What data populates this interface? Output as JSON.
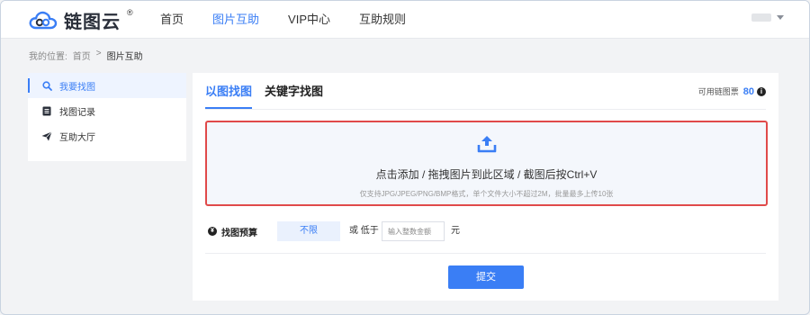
{
  "header": {
    "logo_text": "链图云",
    "logo_reg": "®",
    "nav": [
      {
        "label": "首页",
        "active": false
      },
      {
        "label": "图片互助",
        "active": true
      },
      {
        "label": "VIP中心",
        "active": false
      },
      {
        "label": "互助规则",
        "active": false
      }
    ]
  },
  "breadcrumb": {
    "prefix": "我的位置:",
    "home": "首页",
    "separator": ">",
    "current": "图片互助"
  },
  "sidebar": {
    "items": [
      {
        "label": "我要找图",
        "icon": "search-icon",
        "active": true
      },
      {
        "label": "找图记录",
        "icon": "document-icon",
        "active": false
      },
      {
        "label": "互助大厅",
        "icon": "paper-plane-icon",
        "active": false
      }
    ]
  },
  "main": {
    "tabs": [
      {
        "label": "以图找图",
        "active": true
      },
      {
        "label": "关键字找图",
        "active": false
      }
    ],
    "quota": {
      "label": "可用链图票",
      "value": "80"
    },
    "upload": {
      "main_text": "点击添加 / 拖拽图片到此区域 / 截图后按Ctrl+V",
      "hint": "仅支持JPG/JPEG/PNG/BMP格式，单个文件大小不超过2M，批量最多上传10张"
    },
    "budget": {
      "label": "找图预算",
      "unlimited": "不限",
      "or_text": "或 低于",
      "placeholder": "输入整数金额",
      "unit": "元"
    },
    "submit": "提交"
  },
  "colors": {
    "accent": "#3a7ef5",
    "highlight_border": "#e04a4a"
  }
}
